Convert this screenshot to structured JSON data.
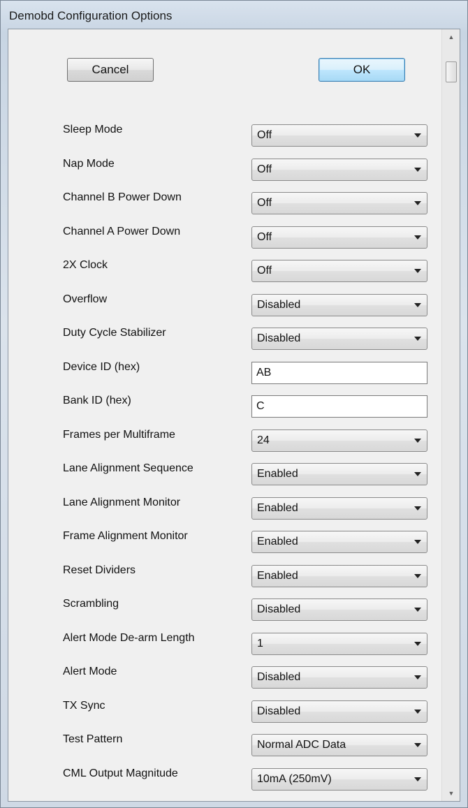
{
  "window": {
    "title": "Demobd Configuration Options"
  },
  "buttons": {
    "cancel": "Cancel",
    "ok": "OK"
  },
  "scrollbar": {
    "up_icon": "▲",
    "down_icon": "▼"
  },
  "options": [
    {
      "label": "Sleep Mode",
      "type": "dropdown",
      "value": "Off"
    },
    {
      "label": "Nap Mode",
      "type": "dropdown",
      "value": "Off"
    },
    {
      "label": "Channel B Power Down",
      "type": "dropdown",
      "value": "Off"
    },
    {
      "label": "Channel A Power Down",
      "type": "dropdown",
      "value": "Off"
    },
    {
      "label": "2X Clock",
      "type": "dropdown",
      "value": "Off"
    },
    {
      "label": "Overflow",
      "type": "dropdown",
      "value": "Disabled"
    },
    {
      "label": "Duty Cycle Stabilizer",
      "type": "dropdown",
      "value": "Disabled"
    },
    {
      "label": "Device ID (hex)",
      "type": "text",
      "value": "AB"
    },
    {
      "label": "Bank ID (hex)",
      "type": "text",
      "value": "C"
    },
    {
      "label": "Frames per Multiframe",
      "type": "dropdown",
      "value": "24"
    },
    {
      "label": "Lane Alignment Sequence",
      "type": "dropdown",
      "value": "Enabled"
    },
    {
      "label": "Lane Alignment Monitor",
      "type": "dropdown",
      "value": "Enabled"
    },
    {
      "label": "Frame Alignment Monitor",
      "type": "dropdown",
      "value": "Enabled"
    },
    {
      "label": "Reset Dividers",
      "type": "dropdown",
      "value": "Enabled"
    },
    {
      "label": "Scrambling",
      "type": "dropdown",
      "value": "Disabled"
    },
    {
      "label": "Alert Mode De-arm Length",
      "type": "dropdown",
      "value": "1"
    },
    {
      "label": "Alert Mode",
      "type": "dropdown",
      "value": "Disabled"
    },
    {
      "label": "TX Sync",
      "type": "dropdown",
      "value": "Disabled"
    },
    {
      "label": "Test Pattern",
      "type": "dropdown",
      "value": "Normal ADC Data"
    },
    {
      "label": "CML Output Magnitude",
      "type": "dropdown",
      "value": "10mA (250mV)"
    }
  ]
}
